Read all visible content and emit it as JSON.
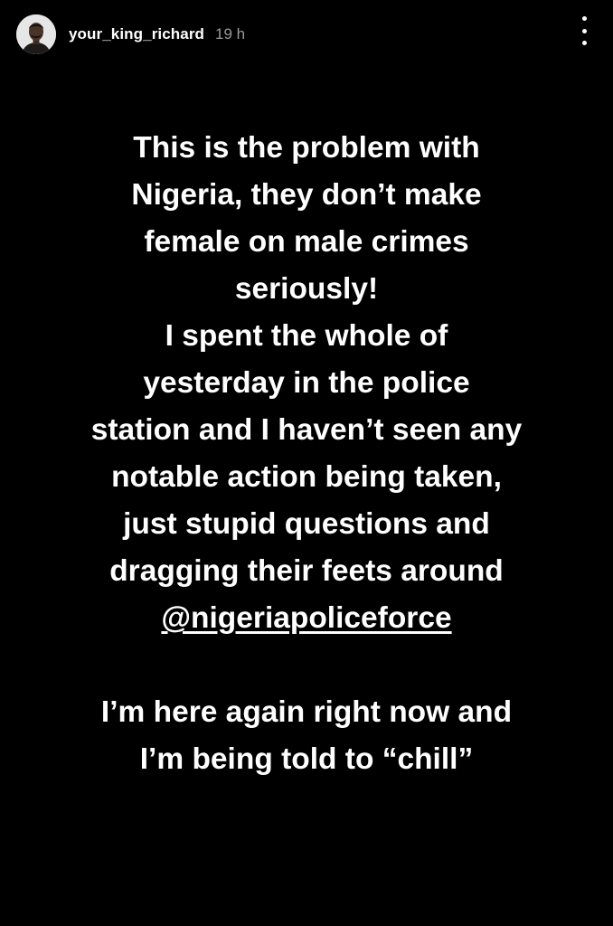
{
  "header": {
    "username": "your_king_richard",
    "timestamp": "19 h",
    "avatar_icon": "user-avatar",
    "more_icon": "vertical-dots-icon"
  },
  "story": {
    "paragraph1": [
      "This is the problem with",
      "Nigeria, they don’t make",
      "female on male crimes",
      "seriously!",
      "I spent the whole of",
      "yesterday in the police",
      "station and I haven’t seen any",
      "notable action being taken,",
      "just stupid questions and",
      "dragging their feets around"
    ],
    "mention": "@nigeriapoliceforce",
    "paragraph2": [
      "I’m here again right now and",
      "I’m being told to “chill”"
    ]
  },
  "colors": {
    "background": "#000000",
    "text": "#ffffff",
    "timestamp": "#9a9a9a"
  }
}
